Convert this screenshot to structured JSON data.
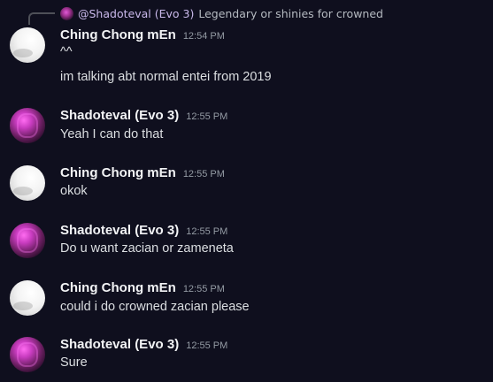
{
  "reply": {
    "author": "@Shadoteval (Evo 3)",
    "text": "Legendary or shinies for crowned"
  },
  "messages": [
    {
      "author": "Ching Chong mEn",
      "time": "12:54 PM",
      "avatar": "white-avatar",
      "lines": [
        "^^",
        "im talking abt normal entei from 2019"
      ]
    },
    {
      "author": "Shadoteval (Evo 3)",
      "time": "12:55 PM",
      "avatar": "pink-avatar",
      "lines": [
        "Yeah I can do that"
      ]
    },
    {
      "author": "Ching Chong mEn",
      "time": "12:55 PM",
      "avatar": "white-avatar",
      "lines": [
        "okok"
      ]
    },
    {
      "author": "Shadoteval (Evo 3)",
      "time": "12:55 PM",
      "avatar": "pink-avatar",
      "lines": [
        "Do u want zacian or zameneta"
      ]
    },
    {
      "author": "Ching Chong mEn",
      "time": "12:55 PM",
      "avatar": "white-avatar",
      "lines": [
        "could i do crowned zacian please"
      ]
    },
    {
      "author": "Shadoteval (Evo 3)",
      "time": "12:55 PM",
      "avatar": "pink-avatar",
      "lines": [
        "Sure"
      ]
    }
  ]
}
